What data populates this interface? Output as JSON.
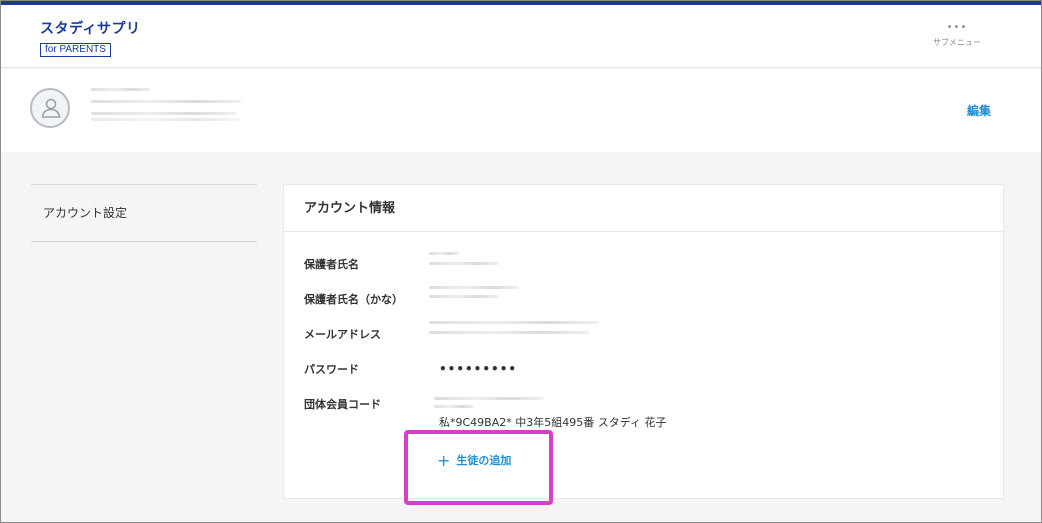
{
  "header": {
    "logo_main": "スタディサプリ",
    "logo_sub": "for PARENTS",
    "submenu_icon": "ellipsis-icon",
    "submenu_label": "サブメニュー"
  },
  "profile": {
    "avatar_icon": "user-icon",
    "edit_label": "編集"
  },
  "sidebar": {
    "items": [
      {
        "label": "アカウント設定"
      }
    ]
  },
  "account": {
    "title": "アカウント情報",
    "fields": {
      "guardian_name": {
        "label": "保護者氏名"
      },
      "guardian_name_kana": {
        "label": "保護者氏名（かな）"
      },
      "email": {
        "label": "メールアドレス"
      },
      "password": {
        "label": "パスワード",
        "value": "•••••••••"
      },
      "org_code": {
        "label": "団体会員コード",
        "value": "私*9C49BA2* 中3年5組495番 スタディ 花子"
      }
    },
    "add_student": {
      "icon": "plus-icon",
      "label": "生徒の追加"
    }
  },
  "colors": {
    "brand": "#1a3a9c",
    "link": "#1e8fd6",
    "highlight": "#d63fc8",
    "background": "#f5f5f5"
  }
}
